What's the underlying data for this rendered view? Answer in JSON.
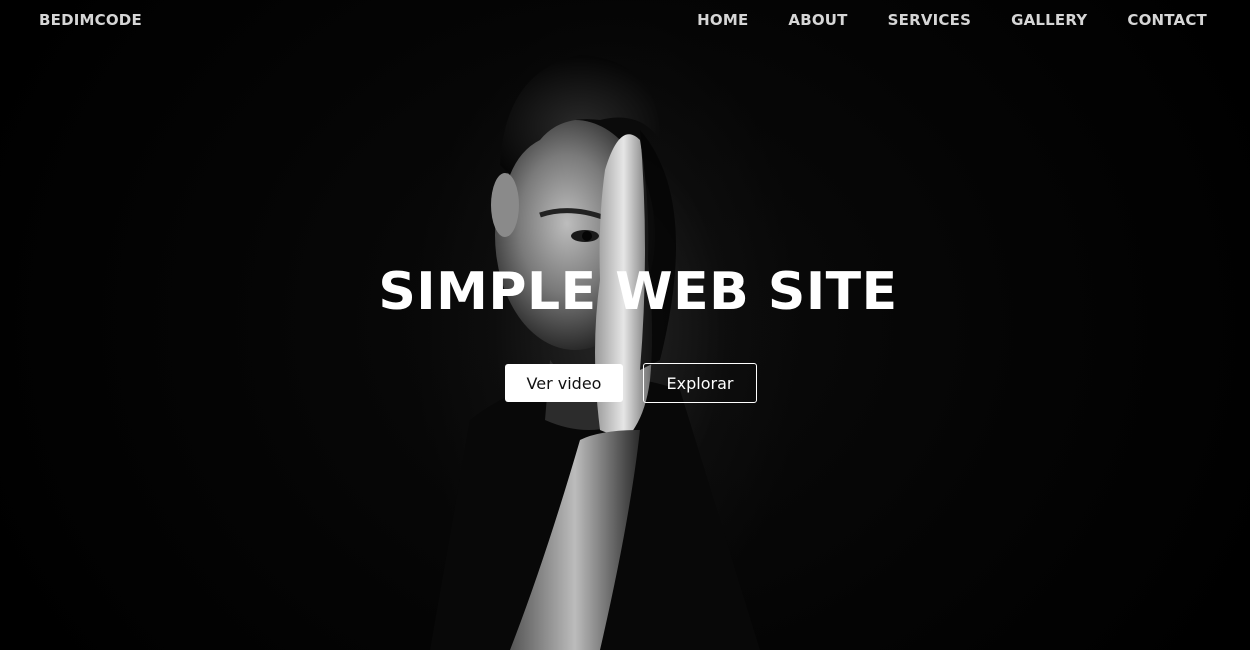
{
  "navbar": {
    "brand": "BEDIMCODE",
    "links": [
      "HOME",
      "ABOUT",
      "SERVICES",
      "GALLERY",
      "CONTACT"
    ]
  },
  "hero": {
    "title": "SIMPLE WEB SITE",
    "primary_button": "Ver video",
    "secondary_button": "Explorar",
    "background_image": "black-and-white portrait of a man covering half his face with his hand"
  },
  "colors": {
    "background": "#000000",
    "nav_text": "#d6d6d6",
    "title_text": "#ffffff",
    "primary_button_bg": "#ffffff",
    "outline_button_border": "#ffffff"
  }
}
